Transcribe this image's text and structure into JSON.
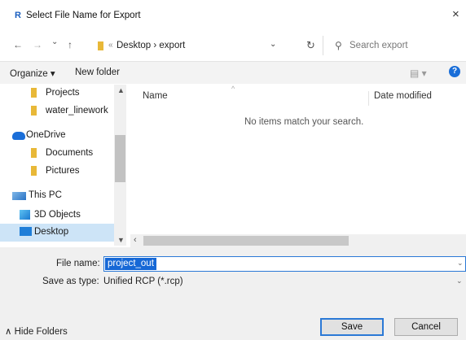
{
  "window": {
    "title": "Select File Name for Export",
    "app_icon": "R",
    "close_glyph": "×"
  },
  "address_bar": {
    "back_glyph": "←",
    "forward_glyph": "→",
    "recent_glyph": "⌄",
    "up_glyph": "↑",
    "separator": "«",
    "path": "Desktop › export",
    "dropdown_glyph": "⌄",
    "refresh_glyph": "↻",
    "search_glyph": "⚲",
    "search_placeholder": "Search export"
  },
  "toolbar": {
    "organize": "Organize ▾",
    "new_folder": "New folder",
    "view_glyph": "▤ ▾",
    "help_glyph": "?"
  },
  "nav_pane": {
    "items": [
      {
        "label": "Projects",
        "icon": "folder-icon"
      },
      {
        "label": "water_linework",
        "icon": "folder-icon"
      },
      {
        "label": "OneDrive",
        "icon": "onedrive-icon"
      },
      {
        "label": "Documents",
        "icon": "folder-icon"
      },
      {
        "label": "Pictures",
        "icon": "folder-icon"
      },
      {
        "label": "This PC",
        "icon": "computer-icon"
      },
      {
        "label": "3D Objects",
        "icon": "3d-objects-icon"
      },
      {
        "label": "Desktop",
        "icon": "desktop-icon",
        "selected": true
      }
    ],
    "scroll_up_glyph": "▲",
    "scroll_down_glyph": "▼"
  },
  "file_list": {
    "columns": [
      "Name",
      "Date modified"
    ],
    "empty_message": "No items match your search.",
    "sort_glyph": "^",
    "hscroll_left_glyph": "‹"
  },
  "form": {
    "file_name_label": "File name:",
    "file_name_value": "project_out",
    "save_as_type_label": "Save as type:",
    "save_as_type_value": "Unified RCP (*.rcp)",
    "chevron_glyph": "⌄"
  },
  "footer": {
    "hide_folders": "∧ Hide Folders",
    "save_button": "Save",
    "cancel_button": "Cancel"
  },
  "colors": {
    "accent": "#1a6ed8",
    "selection": "#cde4f7",
    "folder": "#e8b838"
  }
}
